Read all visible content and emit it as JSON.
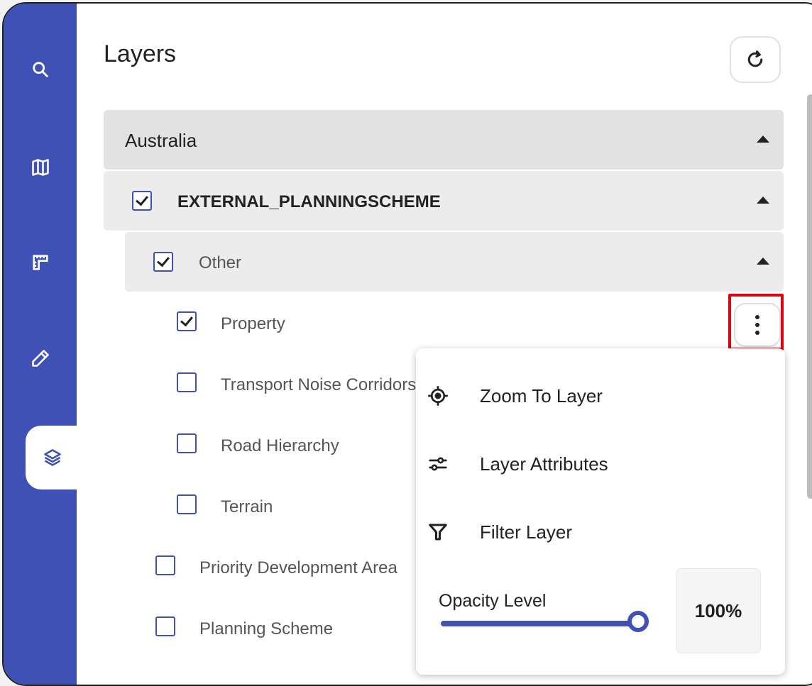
{
  "panel": {
    "title": "Layers"
  },
  "rail": {
    "items": [
      {
        "icon": "search-icon"
      },
      {
        "icon": "map-icon"
      },
      {
        "icon": "measure-icon"
      },
      {
        "icon": "pencil-icon"
      },
      {
        "icon": "layers-icon",
        "active": true
      }
    ]
  },
  "tree": {
    "root": {
      "label": "Australia"
    },
    "scheme": {
      "label": "EXTERNAL_PLANNINGSCHEME",
      "checked": true
    },
    "other": {
      "label": "Other",
      "checked": true
    },
    "items": [
      {
        "label": "Property",
        "checked": true
      },
      {
        "label": "Transport Noise Corridors",
        "checked": false
      },
      {
        "label": "Road Hierarchy",
        "checked": false
      },
      {
        "label": "Terrain",
        "checked": false
      }
    ],
    "siblings": [
      {
        "label": "Priority Development Area",
        "checked": false
      },
      {
        "label": "Planning Scheme",
        "checked": false
      }
    ]
  },
  "menu": {
    "zoom_label": "Zoom To Layer",
    "attributes_label": "Layer Attributes",
    "filter_label": "Filter Layer",
    "opacity_label": "Opacity Level",
    "opacity_value": "100%",
    "opacity_fraction": 1.0
  },
  "colors": {
    "accent": "#3f51b5",
    "highlight": "#e3000f"
  }
}
